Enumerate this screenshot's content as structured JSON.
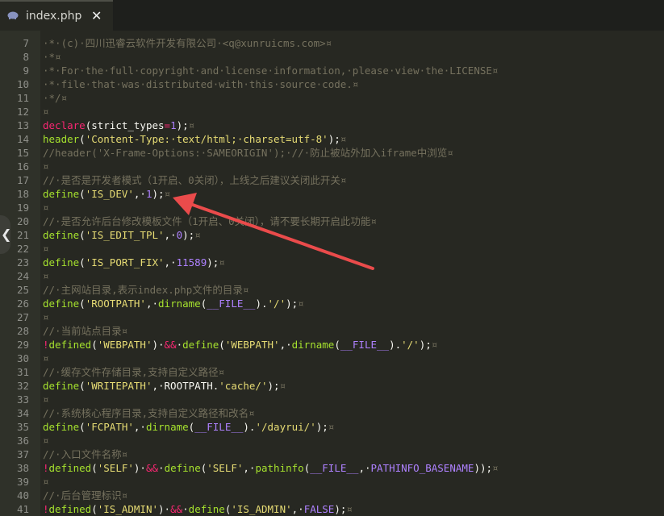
{
  "tab": {
    "filename": "index.php",
    "close_label": "✕",
    "icon": "php-elephant-icon"
  },
  "side_panel": {
    "toggle_icon": "chevron-left-icon",
    "glyph": "❮"
  },
  "colors": {
    "background": "#272822",
    "gutter": "#2f3129",
    "comment": "#75715e",
    "keyword": "#f92672",
    "function": "#a6e22e",
    "string": "#e6db74",
    "number": "#ae81ff",
    "constant": "#ae81ff",
    "arrow": "#ea4b4b"
  },
  "lines": [
    {
      "num": "7",
      "tokens": [
        [
          "c",
          "·*·(c)·四川迅睿云软件开发有限公司·<q@xunruicms.com>¤"
        ]
      ]
    },
    {
      "num": "8",
      "tokens": [
        [
          "c",
          "·*¤"
        ]
      ]
    },
    {
      "num": "9",
      "tokens": [
        [
          "c",
          "·*·For·the·full·copyright·and·license·information,·please·view·the·LICENSE¤"
        ]
      ]
    },
    {
      "num": "10",
      "tokens": [
        [
          "c",
          "·*·file·that·was·distributed·with·this·source·code.¤"
        ]
      ]
    },
    {
      "num": "11",
      "tokens": [
        [
          "c",
          "·*/¤"
        ]
      ]
    },
    {
      "num": "12",
      "tokens": [
        [
          "c",
          "¤"
        ]
      ]
    },
    {
      "num": "13",
      "tokens": [
        [
          "k",
          "declare"
        ],
        [
          "p",
          "(strict_types"
        ],
        [
          "k",
          "="
        ],
        [
          "n",
          "1"
        ],
        [
          "p",
          ");"
        ],
        [
          "c",
          "¤"
        ]
      ]
    },
    {
      "num": "14",
      "tokens": [
        [
          "f",
          "header"
        ],
        [
          "p",
          "("
        ],
        [
          "s",
          "'Content-Type:·text/html;·charset=utf-8'"
        ],
        [
          "p",
          ");"
        ],
        [
          "c",
          "¤"
        ]
      ]
    },
    {
      "num": "15",
      "tokens": [
        [
          "c",
          "//header('X-Frame-Options:·SAMEORIGIN');·//·防止被站外加入iframe中浏览¤"
        ]
      ]
    },
    {
      "num": "16",
      "tokens": [
        [
          "c",
          "¤"
        ]
      ]
    },
    {
      "num": "17",
      "tokens": [
        [
          "c",
          "//·是否是开发者模式（1开启、0关闭），上线之后建议关闭此开关¤"
        ]
      ]
    },
    {
      "num": "18",
      "tokens": [
        [
          "f",
          "define"
        ],
        [
          "p",
          "("
        ],
        [
          "s",
          "'IS_DEV'"
        ],
        [
          "p",
          ",·"
        ],
        [
          "n",
          "1"
        ],
        [
          "p",
          ");"
        ],
        [
          "c",
          "¤"
        ]
      ]
    },
    {
      "num": "19",
      "tokens": [
        [
          "c",
          "¤"
        ]
      ]
    },
    {
      "num": "20",
      "tokens": [
        [
          "c",
          "//·是否允许后台修改模板文件（1开启、0关闭），请不要长期开启此功能¤"
        ]
      ]
    },
    {
      "num": "21",
      "tokens": [
        [
          "f",
          "define"
        ],
        [
          "p",
          "("
        ],
        [
          "s",
          "'IS_EDIT_TPL'"
        ],
        [
          "p",
          ",·"
        ],
        [
          "n",
          "0"
        ],
        [
          "p",
          ");"
        ],
        [
          "c",
          "¤"
        ]
      ]
    },
    {
      "num": "22",
      "tokens": [
        [
          "c",
          "¤"
        ]
      ]
    },
    {
      "num": "23",
      "tokens": [
        [
          "f",
          "define"
        ],
        [
          "p",
          "("
        ],
        [
          "s",
          "'IS_PORT_FIX'"
        ],
        [
          "p",
          ",·"
        ],
        [
          "n",
          "11589"
        ],
        [
          "p",
          ");"
        ],
        [
          "c",
          "¤"
        ]
      ]
    },
    {
      "num": "24",
      "tokens": [
        [
          "c",
          "¤"
        ]
      ]
    },
    {
      "num": "25",
      "tokens": [
        [
          "c",
          "//·主网站目录,表示index.php文件的目录¤"
        ]
      ]
    },
    {
      "num": "26",
      "tokens": [
        [
          "f",
          "define"
        ],
        [
          "p",
          "("
        ],
        [
          "s",
          "'ROOTPATH'"
        ],
        [
          "p",
          ",·"
        ],
        [
          "f",
          "dirname"
        ],
        [
          "p",
          "("
        ],
        [
          "n",
          "__FILE__"
        ],
        [
          "p",
          ")."
        ],
        [
          "s",
          "'/'"
        ],
        [
          "p",
          ");"
        ],
        [
          "c",
          "¤"
        ]
      ]
    },
    {
      "num": "27",
      "tokens": [
        [
          "c",
          "¤"
        ]
      ]
    },
    {
      "num": "28",
      "tokens": [
        [
          "c",
          "//·当前站点目录¤"
        ]
      ]
    },
    {
      "num": "29",
      "tokens": [
        [
          "k",
          "!"
        ],
        [
          "f",
          "defined"
        ],
        [
          "p",
          "("
        ],
        [
          "s",
          "'WEBPATH'"
        ],
        [
          "p",
          ")·"
        ],
        [
          "k",
          "&&"
        ],
        [
          "p",
          "·"
        ],
        [
          "f",
          "define"
        ],
        [
          "p",
          "("
        ],
        [
          "s",
          "'WEBPATH'"
        ],
        [
          "p",
          ",·"
        ],
        [
          "f",
          "dirname"
        ],
        [
          "p",
          "("
        ],
        [
          "n",
          "__FILE__"
        ],
        [
          "p",
          ")."
        ],
        [
          "s",
          "'/'"
        ],
        [
          "p",
          ");"
        ],
        [
          "c",
          "¤"
        ]
      ]
    },
    {
      "num": "30",
      "tokens": [
        [
          "c",
          "¤"
        ]
      ]
    },
    {
      "num": "31",
      "tokens": [
        [
          "c",
          "//·缓存文件存储目录,支持自定义路径¤"
        ]
      ]
    },
    {
      "num": "32",
      "tokens": [
        [
          "f",
          "define"
        ],
        [
          "p",
          "("
        ],
        [
          "s",
          "'WRITEPATH'"
        ],
        [
          "p",
          ",·ROOTPATH."
        ],
        [
          "s",
          "'cache/'"
        ],
        [
          "p",
          ");"
        ],
        [
          "c",
          "¤"
        ]
      ]
    },
    {
      "num": "33",
      "tokens": [
        [
          "c",
          "¤"
        ]
      ]
    },
    {
      "num": "34",
      "tokens": [
        [
          "c",
          "//·系统核心程序目录,支持自定义路径和改名¤"
        ]
      ]
    },
    {
      "num": "35",
      "tokens": [
        [
          "f",
          "define"
        ],
        [
          "p",
          "("
        ],
        [
          "s",
          "'FCPATH'"
        ],
        [
          "p",
          ",·"
        ],
        [
          "f",
          "dirname"
        ],
        [
          "p",
          "("
        ],
        [
          "n",
          "__FILE__"
        ],
        [
          "p",
          ")."
        ],
        [
          "s",
          "'/dayrui/'"
        ],
        [
          "p",
          ");"
        ],
        [
          "c",
          "¤"
        ]
      ]
    },
    {
      "num": "36",
      "tokens": [
        [
          "c",
          "¤"
        ]
      ]
    },
    {
      "num": "37",
      "tokens": [
        [
          "c",
          "//·入口文件名称¤"
        ]
      ]
    },
    {
      "num": "38",
      "tokens": [
        [
          "k",
          "!"
        ],
        [
          "f",
          "defined"
        ],
        [
          "p",
          "("
        ],
        [
          "s",
          "'SELF'"
        ],
        [
          "p",
          ")·"
        ],
        [
          "k",
          "&&"
        ],
        [
          "p",
          "·"
        ],
        [
          "f",
          "define"
        ],
        [
          "p",
          "("
        ],
        [
          "s",
          "'SELF'"
        ],
        [
          "p",
          ",·"
        ],
        [
          "f",
          "pathinfo"
        ],
        [
          "p",
          "("
        ],
        [
          "n",
          "__FILE__"
        ],
        [
          "p",
          ",·"
        ],
        [
          "n",
          "PATHINFO_BASENAME"
        ],
        [
          "p",
          "));"
        ],
        [
          "c",
          "¤"
        ]
      ]
    },
    {
      "num": "39",
      "tokens": [
        [
          "c",
          "¤"
        ]
      ]
    },
    {
      "num": "40",
      "tokens": [
        [
          "c",
          "//·后台管理标识¤"
        ]
      ]
    },
    {
      "num": "41",
      "tokens": [
        [
          "k",
          "!"
        ],
        [
          "f",
          "defined"
        ],
        [
          "p",
          "("
        ],
        [
          "s",
          "'IS_ADMIN'"
        ],
        [
          "p",
          ")·"
        ],
        [
          "k",
          "&&"
        ],
        [
          "p",
          "·"
        ],
        [
          "f",
          "define"
        ],
        [
          "p",
          "("
        ],
        [
          "s",
          "'IS_ADMIN'"
        ],
        [
          "p",
          ",·"
        ],
        [
          "n",
          "FALSE"
        ],
        [
          "p",
          ");"
        ],
        [
          "c",
          "¤"
        ]
      ]
    }
  ]
}
